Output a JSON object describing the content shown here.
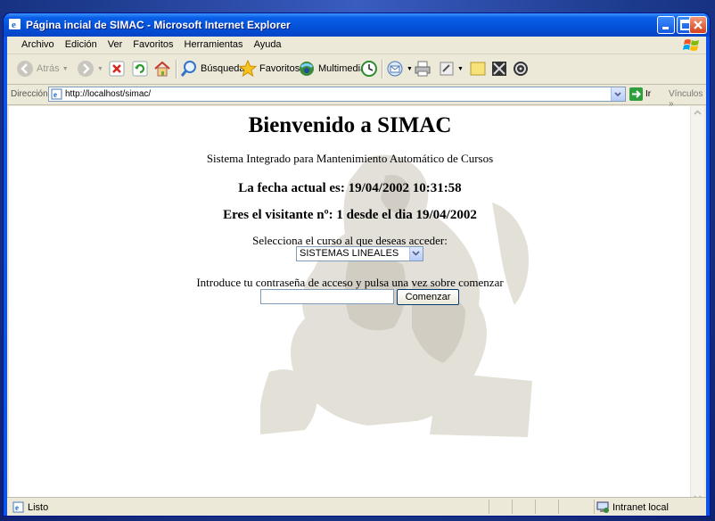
{
  "window": {
    "title": "Página incial de SIMAC - Microsoft Internet Explorer"
  },
  "menu": [
    "Archivo",
    "Edición",
    "Ver",
    "Favoritos",
    "Herramientas",
    "Ayuda"
  ],
  "toolbar": {
    "back_label": "Atrás",
    "search_label": "Búsqueda",
    "favorites_label": "Favoritos",
    "multimedia_label": "Multimedia"
  },
  "address": {
    "label": "Dirección",
    "url": "http://localhost/simac/",
    "go_label": "Ir",
    "links_label": "Vínculos"
  },
  "page": {
    "heading": "Bienvenido a SIMAC",
    "subtitle": "Sistema Integrado para Mantenimiento Automático de Cursos",
    "date_line": "La fecha actual es: 19/04/2002 10:31:58",
    "visitor_line": "Eres el visitante nº: 1 desde el dia 19/04/2002",
    "course_prompt": "Selecciona el curso al que deseas acceder:",
    "course_selected": "SISTEMAS LINEALES",
    "password_prompt": "Introduce tu contraseña de acceso y pulsa una vez sobre comenzar",
    "password_value": "",
    "start_button": "Comenzar"
  },
  "status": {
    "text": "Listo",
    "zone": "Intranet local"
  },
  "colors": {
    "titlebar": "#0351d8",
    "chrome": "#ece9d8",
    "accent_border": "#7f9db9"
  }
}
